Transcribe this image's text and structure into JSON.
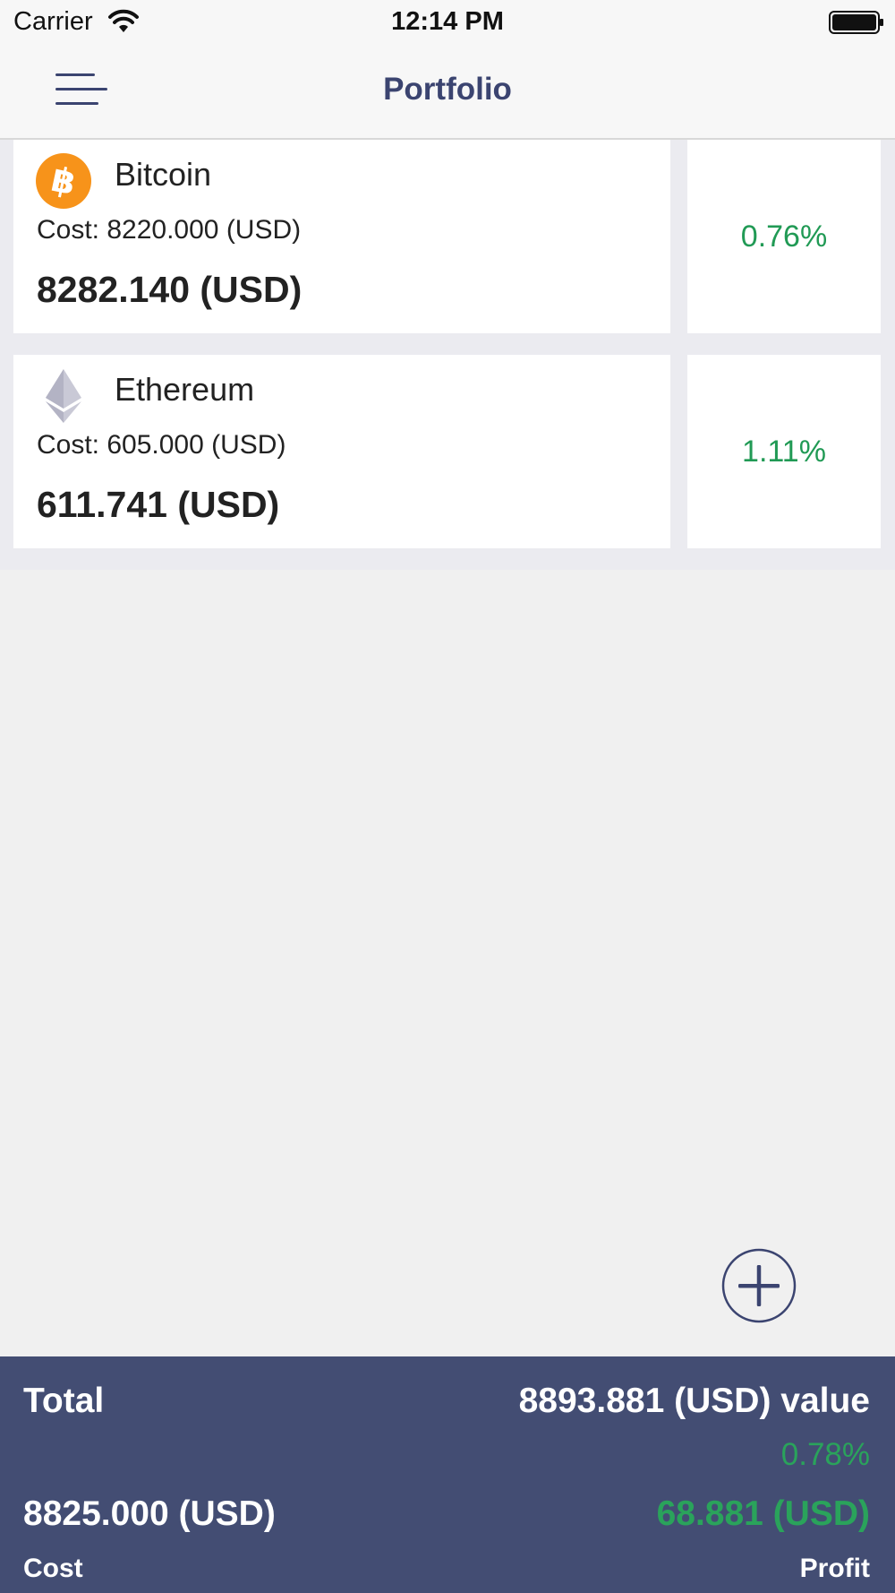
{
  "status_bar": {
    "carrier": "Carrier",
    "time": "12:14 PM"
  },
  "nav": {
    "title": "Portfolio",
    "menu_icon": "hamburger-menu-icon"
  },
  "holdings": [
    {
      "name": "Bitcoin",
      "icon": "bitcoin-icon",
      "cost": "Cost: 8220.000 (USD)",
      "value": "8282.140 (USD)",
      "change": "0.76%"
    },
    {
      "name": "Ethereum",
      "icon": "ethereum-icon",
      "cost": "Cost: 605.000 (USD)",
      "value": "611.741 (USD)",
      "change": "1.11%"
    }
  ],
  "add_button": {
    "icon": "plus-circle-icon"
  },
  "footer": {
    "total_label": "Total",
    "total_value": "8893.881 (USD) value",
    "total_change": "0.78%",
    "cost_value": "8825.000 (USD)",
    "profit_value": "68.881 (USD)",
    "cost_label": "Cost",
    "profit_label": "Profit"
  },
  "colors": {
    "accent": "#3b4470",
    "footer_bg": "#434d73",
    "positive": "#219a55",
    "bitcoin": "#f7931a"
  }
}
